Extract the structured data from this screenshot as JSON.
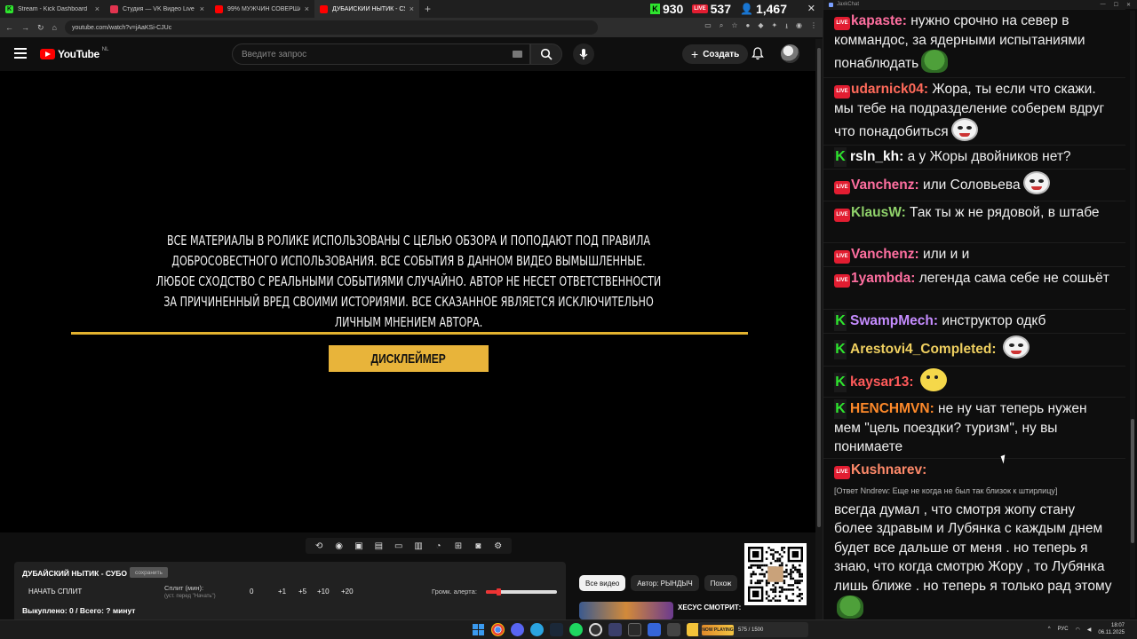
{
  "browser": {
    "tabs": [
      {
        "label": "Stream - Kick Dashboard",
        "fav_color": "#2ee52e",
        "fav_char": "K"
      },
      {
        "label": "Студия — VK Видео Live",
        "fav_color": "#e2344f",
        "fav_char": ""
      },
      {
        "label": "99% МУЖЧИН СОВЕРШАЮТ...",
        "fav_color": "#ff0000",
        "fav_char": ""
      },
      {
        "label": "ДУБАЙСКИЙ НЫТИК - СУБО",
        "fav_color": "#ff0000",
        "fav_char": "",
        "active": true
      }
    ],
    "new_tab": "+",
    "url": "youtube.com/watch?v=jAaKSi-CJUc",
    "counters": {
      "kick": "930",
      "vk": "537",
      "viewers": "1,467"
    },
    "close_glyph": "✕"
  },
  "youtube": {
    "logo_text": "YouTube",
    "country_code": "NL",
    "search_placeholder": "Введите запрос",
    "create_label": "Создать",
    "video": {
      "disclaimer_text": "ВСЕ МАТЕРИАЛЫ В РОЛИКЕ ИСПОЛЬЗОВАНЫ С ЦЕЛЬЮ ОБЗОРА И ПОПОДАЮТ ПОД ПРАВИЛА ДОБРОСОВЕСТНОГО ИСПОЛЬЗОВАНИЯ. ВСЕ СОБЫТИЯ В ДАННОМ ВИДЕО ВЫМЫШЛЕННЫЕ. ЛЮБОЕ СХОДСТВО С РЕАЛЬНЫМИ СОБЫТИЯМИ СЛУЧАЙНО. АВТОР НЕ НЕСЕТ ОТВЕТСТВЕННОСТИ ЗА ПРИЧИНЕННЫЙ ВРЕД СВОИМИ ИСТОРИЯМИ. ВСЕ СКАЗАННОЕ ЯВЛЯЕТСЯ ИСКЛЮЧИТЕЛЬНО ЛИЧНЫМ МНЕНИЕМ АВТОРА.",
      "badge": "ДИСКЛЕЙМЕР",
      "accent": "#e8b43a"
    },
    "split_panel": {
      "title": "ДУБАЙСКИЙ НЫТИК - СУБО",
      "badge": "сохранить",
      "start_label": "НАЧАТЬ СПЛИТ",
      "split_label": "Сплит (мин):",
      "split_sub": "(уст. перед \"Начать\")",
      "split_value": "0",
      "increments": [
        "+1",
        "+5",
        "+10",
        "+20"
      ],
      "alert_label": "Громк. алерта:",
      "alert_level_percent": 18,
      "stats": "Выкуплено: 0 / Всего: ? минут"
    },
    "chips": [
      "Все видео",
      "Автор: РЫНДЫЧ",
      "Похож"
    ],
    "recommended_title": "ХЕСУС СМОТРИТ:"
  },
  "chat": {
    "window_title": "JaxkChat",
    "messages": [
      {
        "platform": "vk",
        "nick": "kapaste",
        "color": "#ff6fa0",
        "text": "нужно срочно на север в коммандос, за ядерными испытаниями понаблюдать",
        "emote": "pepe"
      },
      {
        "platform": "vk",
        "nick": "udarnick04",
        "color": "#ff6a5a",
        "text": "Жора, ты если что скажи. мы тебе на подразделение соберем вдруг что понадобиться",
        "emote": "mask"
      },
      {
        "platform": "kick",
        "nick": "rsln_kh",
        "color": "#ffffff",
        "text": "а у Жоры двойников нет?",
        "emote": ""
      },
      {
        "platform": "vk",
        "nick": "Vanchenz",
        "color": "#ff6fa0",
        "text": "или Соловьева",
        "emote": "mask"
      },
      {
        "platform": "vk",
        "nick": "KlausW",
        "color": "#8fd16a",
        "text": "Так ты ж не рядовой, в штабе",
        "emote": ""
      },
      {
        "platform": "vk",
        "nick": "Vanchenz",
        "color": "#ff6fa0",
        "text": "или и и",
        "emote": ""
      },
      {
        "platform": "vk",
        "nick": "1yambda",
        "color": "#ff6fa0",
        "text": "легенда сама себе не сошьёт",
        "emote": ""
      },
      {
        "platform": "kick",
        "nick": "SwampMech",
        "color": "#c58cff",
        "text": "инструктор одкб",
        "emote": ""
      },
      {
        "platform": "kick",
        "nick": "Arestovi4_Completed",
        "color": "#f0d060",
        "text": "",
        "emote": "mask"
      },
      {
        "platform": "kick",
        "nick": "kaysar13",
        "color": "#ff5a5a",
        "text": "",
        "emote": "smile"
      },
      {
        "platform": "kick",
        "nick": "HENCHMVN",
        "color": "#ff8a2a",
        "text": "не ну чат теперь нужен мем \"цель поездки? туризм\", ну вы понимаете",
        "emote": ""
      },
      {
        "platform": "vk",
        "nick": "Kushnarev",
        "color": "#ff8a6a",
        "reply": "[Ответ Nndrew: Еще не когда не был так близок к штирлицу]",
        "text": "всегда думал , что смотря жопу стану более здравым и Лубянка с каждым днем будет все дальше от меня . но теперь я знаю, что когда смотрю Жору , то Лубянка лишь ближе . но теперь я только рад этому",
        "emote": "pepe"
      }
    ]
  },
  "taskbar": {
    "media_art": "NOW PLAYING",
    "media_text": "575 / 1500",
    "lang": "РУС",
    "time": "18:07",
    "date": "06.11.2025"
  }
}
